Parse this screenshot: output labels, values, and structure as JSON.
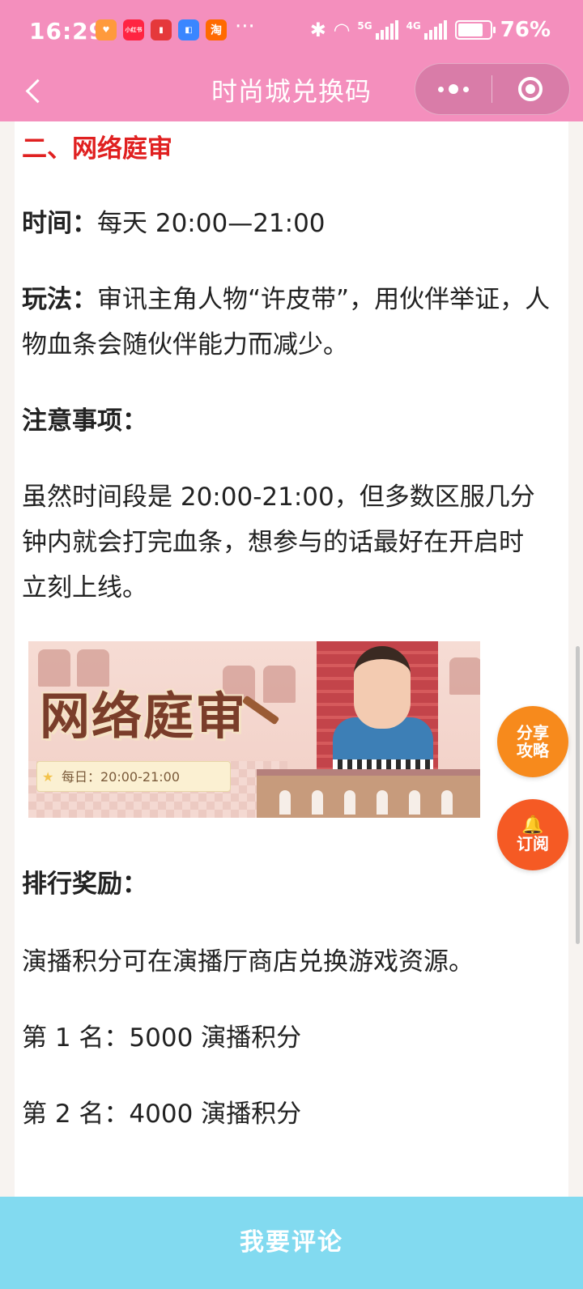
{
  "status_bar": {
    "time": "16:29",
    "apps": [
      {
        "name": "heart-app-icon",
        "label": "",
        "color": "#ff9a3c"
      },
      {
        "name": "xiaohongshu-icon",
        "label": "小红书",
        "color": "#ff2442"
      },
      {
        "name": "book-app-icon",
        "label": "",
        "color": "#e5383b"
      },
      {
        "name": "notes-app-icon",
        "label": "",
        "color": "#3a86ff"
      },
      {
        "name": "taobao-icon",
        "label": "淘",
        "color": "#ff6a00"
      }
    ],
    "more": "···",
    "net_5g": "5G",
    "net_4g": "4G",
    "battery": "76%"
  },
  "nav": {
    "title": "时尚城兑换码"
  },
  "article": {
    "section_title": "二、网络庭审",
    "time_label": "时间：",
    "time_value": "每天 20:00—21:00",
    "play_label": "玩法：",
    "play_line1": "审讯主角人物“许皮带”，用伙伴举证，人",
    "play_line2": "物血条会随伙伴能力而减少。",
    "notes_label": "注意事项：",
    "notes_line1": "虽然时间段是 20:00-21:00，但多数区服几分",
    "notes_line2": "钟内就会打完血条，想参与的话最好在开启时",
    "notes_line3": "立刻上线。",
    "banner_title": "网络庭审",
    "banner_tag": "每日：20:00-21:00",
    "rank_label": "排行奖励：",
    "rank_desc": "演播积分可在演播厅商店兑换游戏资源。",
    "rank_1": "第 1 名：5000 演播积分",
    "rank_2": "第 2 名：4000 演播积分"
  },
  "fab": {
    "share_line1": "分享",
    "share_line2": "攻略",
    "subscribe_icon": "🔔",
    "subscribe": "订阅"
  },
  "bottom": {
    "comment": "我要评论"
  },
  "colors": {
    "header": "#f48fbd",
    "section_title": "#e02020",
    "share_button": "#f78a1c",
    "subscribe_button": "#f55a24",
    "bottom_bar": "#82daf0"
  }
}
